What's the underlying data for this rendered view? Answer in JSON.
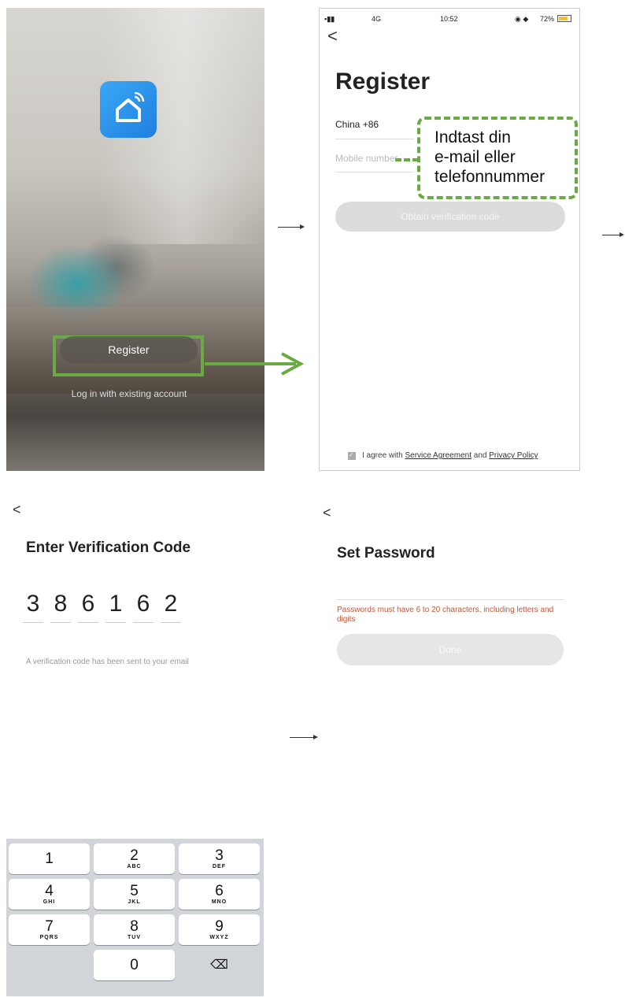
{
  "splash": {
    "register_label": "Register",
    "login_label": "Log in with existing account"
  },
  "register_screen": {
    "status": {
      "signal": "4G",
      "time": "10:52",
      "battery": "72%"
    },
    "back_glyph": "<",
    "title": "Register",
    "country": "China +86",
    "mobile_placeholder": "Mobile number",
    "obtain_label": "Obtain verification code",
    "callout_text": [
      "Indtast din",
      "e-mail eller",
      "telefonnummer"
    ],
    "agree": {
      "prefix": "I agree with",
      "service": "Service Agreement",
      "and": "and",
      "privacy": "Privacy Policy"
    }
  },
  "verification_screen": {
    "back_glyph": "<",
    "title": "Enter Verification Code",
    "digits": [
      "3",
      "8",
      "6",
      "1",
      "6",
      "2"
    ],
    "note": "A verification code has been sent to your email"
  },
  "keypad": {
    "keys": [
      {
        "num": "1",
        "letters": ""
      },
      {
        "num": "2",
        "letters": "ABC"
      },
      {
        "num": "3",
        "letters": "DEF"
      },
      {
        "num": "4",
        "letters": "GHI"
      },
      {
        "num": "5",
        "letters": "JKL"
      },
      {
        "num": "6",
        "letters": "MNO"
      },
      {
        "num": "7",
        "letters": "PQRS"
      },
      {
        "num": "8",
        "letters": "TUV"
      },
      {
        "num": "9",
        "letters": "WXYZ"
      },
      {
        "num": "0",
        "letters": ""
      }
    ],
    "delete_glyph": "⌫"
  },
  "password_screen": {
    "back_glyph": "<",
    "title": "Set Password",
    "hint": "Passwords must have 6 to 20 characters, including letters and digits",
    "done_label": "Done"
  },
  "colors": {
    "highlight": "#6aaa45",
    "app_blue": "#2a93ee",
    "hint_red": "#c0593a"
  }
}
